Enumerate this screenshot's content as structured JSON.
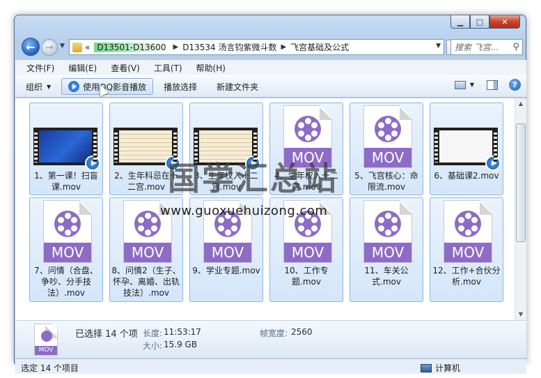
{
  "window": {
    "controls": [
      "minimize",
      "maximize",
      "close"
    ]
  },
  "nav": {
    "breadcrumb_overflow": "«",
    "breadcrumbs": [
      "D13501-D13600",
      "D13534 汤言钧紫微斗数",
      "飞宫基础及公式"
    ],
    "search_placeholder": "搜索 飞宫..."
  },
  "menu": [
    "文件(F)",
    "编辑(E)",
    "查看(V)",
    "工具(T)",
    "帮助(H)"
  ],
  "toolbar": {
    "organize": "组织",
    "play_with": "使用QQ影音播放",
    "play_selection": "播放选择",
    "new_folder": "新建文件夹"
  },
  "files": [
    {
      "name": "1、第一课！扫盲课.mov",
      "thumb": "video-blue"
    },
    {
      "name": "2、生年科忌在十二宫.mov",
      "thumb": "video-paper"
    },
    {
      "name": "3、生年权入十二宫.mov",
      "thumb": "video-paper"
    },
    {
      "name": "4、生年权入十二宫.mov",
      "thumb": "mov-icon"
    },
    {
      "name": "5、飞宫核心：命限流.mov",
      "thumb": "mov-icon"
    },
    {
      "name": "6、基础课2.mov",
      "thumb": "video-white"
    },
    {
      "name": "7、问情（合盘、争吵、分手技法）.mov",
      "thumb": "mov-icon"
    },
    {
      "name": "8、问情2（生子、怀孕、离婚、出轨技法）.mov",
      "thumb": "mov-icon"
    },
    {
      "name": "9、学业专题.mov",
      "thumb": "mov-icon"
    },
    {
      "name": "10、工作专题.mov",
      "thumb": "mov-icon"
    },
    {
      "name": "11、车关公式.mov",
      "thumb": "mov-icon"
    },
    {
      "name": "12、工作+合伙分析.mov",
      "thumb": "mov-icon"
    }
  ],
  "mov_badge_text": "MOV",
  "details": {
    "selected": "已选择 14 个项",
    "length_label": "长度:",
    "length_value": "11:53:17",
    "size_label": "大小:",
    "size_value": "15.9 GB",
    "framewidth_label": "帧宽度:",
    "framewidth_value": "2560"
  },
  "status": {
    "left": "选定 14 个项目",
    "right": "计算机"
  },
  "watermark": {
    "cn": "国学汇总站",
    "en": "www.guoxuehuizong.com"
  }
}
